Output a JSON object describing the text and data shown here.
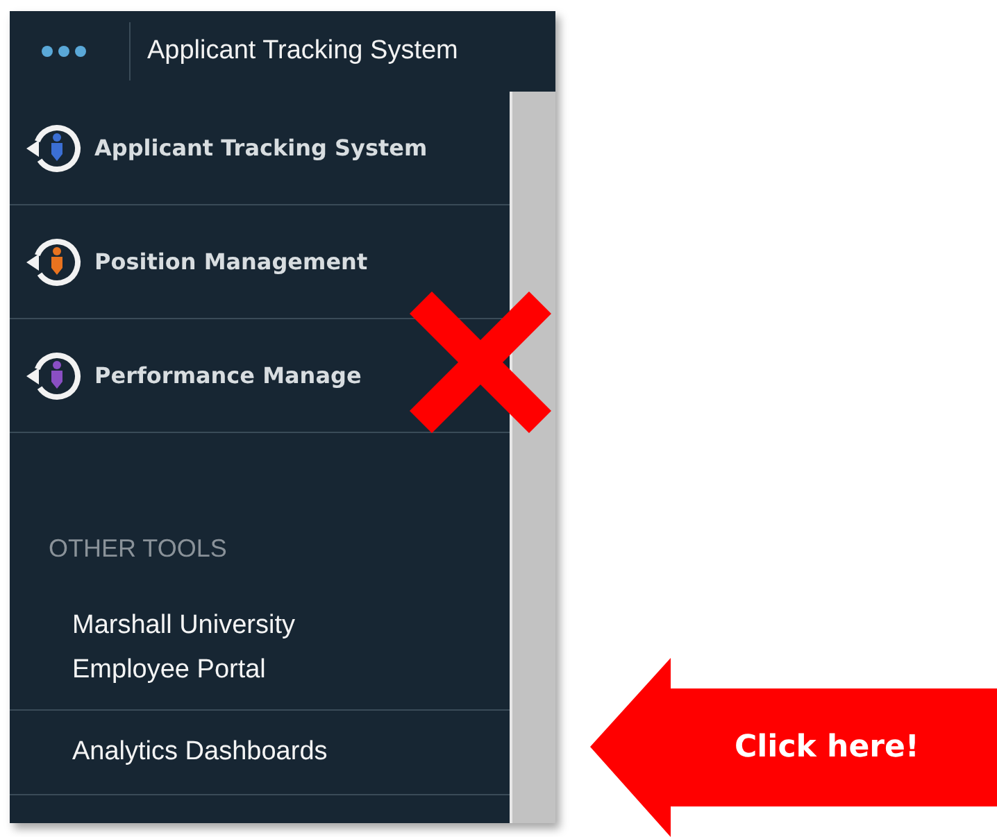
{
  "header": {
    "title": "Applicant Tracking System"
  },
  "modules": [
    {
      "label": "Applicant Tracking System",
      "color": "#3b6fd4"
    },
    {
      "label": "Position Management",
      "color": "#e8731f"
    },
    {
      "label": "Performance Manage",
      "color": "#8a4fc4"
    }
  ],
  "other_tools": {
    "heading": "OTHER TOOLS",
    "links": [
      {
        "label": "Marshall University Employee Portal"
      },
      {
        "label": "Analytics Dashboards"
      }
    ]
  },
  "callout": {
    "text": "Click here!"
  }
}
